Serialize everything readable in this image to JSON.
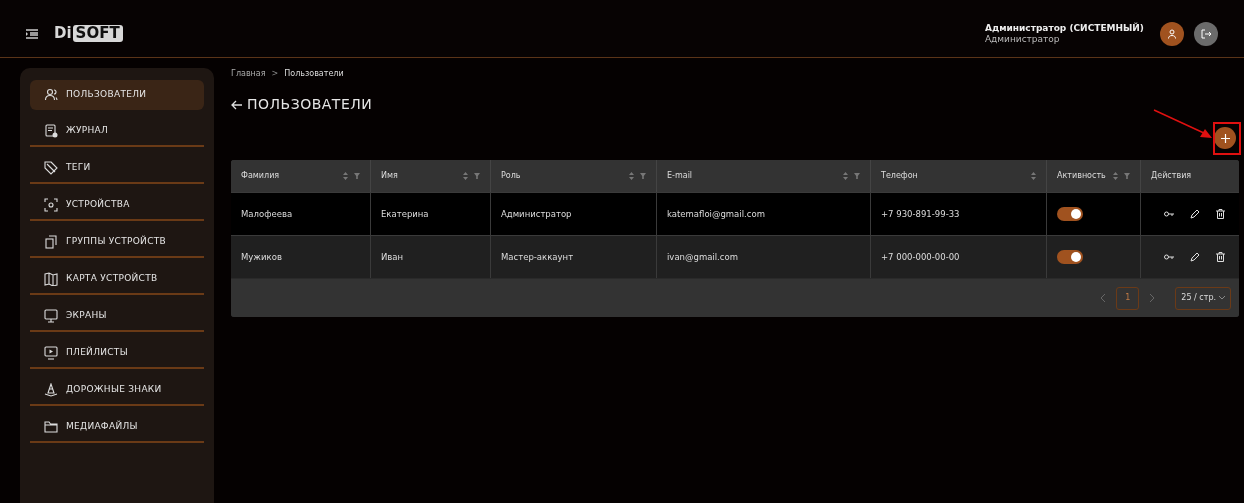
{
  "header": {
    "logo_left": "Di",
    "logo_right": "SOFT",
    "user_name": "Администратор (СИСТЕМНЫЙ)",
    "user_role": "Администратор"
  },
  "sidebar": {
    "items": [
      {
        "label": "ПОЛЬЗОВАТЕЛИ",
        "kind": "users",
        "selected": true
      },
      {
        "label": "ЖУРНАЛ",
        "kind": "log",
        "selected": false
      },
      {
        "label": "ТЕГИ",
        "kind": "tag",
        "selected": false
      },
      {
        "label": "УСТРОЙСТВА",
        "kind": "device",
        "selected": false
      },
      {
        "label": "ГРУППЫ УСТРОЙСТВ",
        "kind": "group",
        "selected": false
      },
      {
        "label": "КАРТА УСТРОЙСТВ",
        "kind": "map",
        "selected": false
      },
      {
        "label": "ЭКРАНЫ",
        "kind": "screen",
        "selected": false
      },
      {
        "label": "ПЛЕЙЛИСТЫ",
        "kind": "playlist",
        "selected": false
      },
      {
        "label": "ДОРОЖНЫЕ ЗНАКИ",
        "kind": "cone",
        "selected": false
      },
      {
        "label": "МЕДИАФАЙЛЫ",
        "kind": "folder",
        "selected": false
      }
    ]
  },
  "breadcrumbs": [
    "Главная",
    "Пользователи"
  ],
  "breadcrumb_separator": ">",
  "page_title": "ПОЛЬЗОВАТЕЛИ",
  "table": {
    "columns": [
      {
        "label": "Фамилия",
        "sortable": true,
        "filterable": true
      },
      {
        "label": "Имя",
        "sortable": true,
        "filterable": true
      },
      {
        "label": "Роль",
        "sortable": true,
        "filterable": true
      },
      {
        "label": "E-mail",
        "sortable": true,
        "filterable": true
      },
      {
        "label": "Телефон",
        "sortable": true,
        "filterable": false
      },
      {
        "label": "Активность",
        "sortable": true,
        "filterable": true
      },
      {
        "label": "Действия",
        "sortable": false,
        "filterable": false
      }
    ],
    "rows": [
      {
        "cells": [
          "Малофеева",
          "Екатерина",
          "Администратор",
          "katemafloi@gmail.com",
          "+7 930-891-99-33"
        ],
        "active": true
      },
      {
        "cells": [
          "Мужиков",
          "Иван",
          "Мастер-аккаунт",
          "ivan@gmail.com",
          "+7 000-000-00-00"
        ],
        "active": true
      }
    ]
  },
  "pagination": {
    "page": "1",
    "page_size": "25 / стр."
  }
}
